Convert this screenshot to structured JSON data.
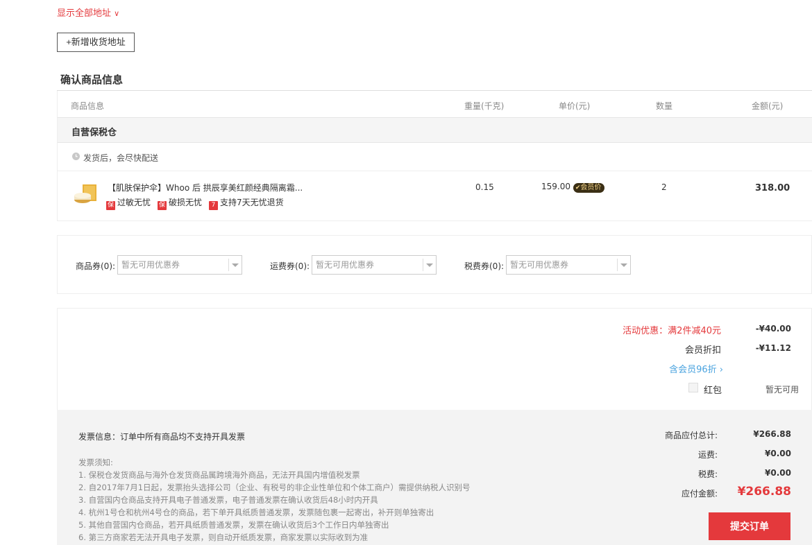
{
  "address": {
    "show_all_label": "显示全部地址",
    "show_all_chevron": "∨",
    "add_button_label": "+新增收货地址"
  },
  "section_title": "确认商品信息",
  "table": {
    "headers": {
      "product": "商品信息",
      "weight": "重量(千克)",
      "unit_price": "单价(元)",
      "quantity": "数量",
      "amount": "金额(元)"
    },
    "warehouse": "自营保税仓",
    "shipping_note": "发货后，会尽快配送",
    "item": {
      "name": "【肌肤保护伞】Whoo 后 拱辰享美红颜经典隔离霜...",
      "weight": "0.15",
      "unit_price": "159.00",
      "vip_badge": "会员价",
      "vip_mark": "✔",
      "quantity": "2",
      "amount": "318.00",
      "tags": [
        {
          "icon": "保",
          "label": "过敏无忧"
        },
        {
          "icon": "保",
          "label": "破损无忧"
        },
        {
          "icon": "7",
          "label": "支持7天无忧退货"
        }
      ]
    }
  },
  "coupons": [
    {
      "label": "商品券(0):",
      "placeholder": "暂无可用优惠券"
    },
    {
      "label": "运费券(0):",
      "placeholder": "暂无可用优惠券"
    },
    {
      "label": "税费券(0):",
      "placeholder": "暂无可用优惠券"
    }
  ],
  "discounts": {
    "activity_label": "活动优惠：满2件减40元",
    "activity_value": "-¥40.00",
    "member_label": "会员折扣",
    "member_value": "-¥11.12",
    "member_rate": "含会员96折",
    "member_rate_chevron": "›",
    "red_packet_label": "红包",
    "red_packet_value": "暂无可用"
  },
  "invoice": {
    "info": "发票信息：订单中所有商品均不支持开具发票",
    "notice_title": "发票须知:",
    "notices": [
      "1. 保税仓发货商品与海外仓发货商品属跨境海外商品，无法开具国内增值税发票",
      "2. 自2017年7月1日起，发票抬头选择公司（企业、有税号的非企业性单位和个体工商户）需提供纳税人识别号",
      "3. 自营国内仓商品支持开具电子普通发票，电子普通发票在确认收货后48小时内开具",
      "4. 杭州1号仓和杭州4号仓的商品，若下单开具纸质普通发票，发票随包裹一起寄出，补开则单独寄出",
      "5. 其他自营国内仓商品，若开具纸质普通发票，发票在确认收货后3个工作日内单独寄出",
      "6. 第三方商家若无法开具电子发票，则自动开纸质发票，商家发票以实际收到为准"
    ]
  },
  "summary": {
    "goods_total_label": "商品应付总计:",
    "goods_total_value": "¥266.88",
    "shipping_label": "运费:",
    "shipping_value": "¥0.00",
    "tax_label": "税费:",
    "tax_value": "¥0.00",
    "payable_label": "应付金额:",
    "payable_value": "¥266.88",
    "submit_label": "提交订单"
  },
  "colors": {
    "accent_red": "#e4393c",
    "link_blue": "#4aa3df",
    "panel_gray": "#f3f3f3"
  }
}
